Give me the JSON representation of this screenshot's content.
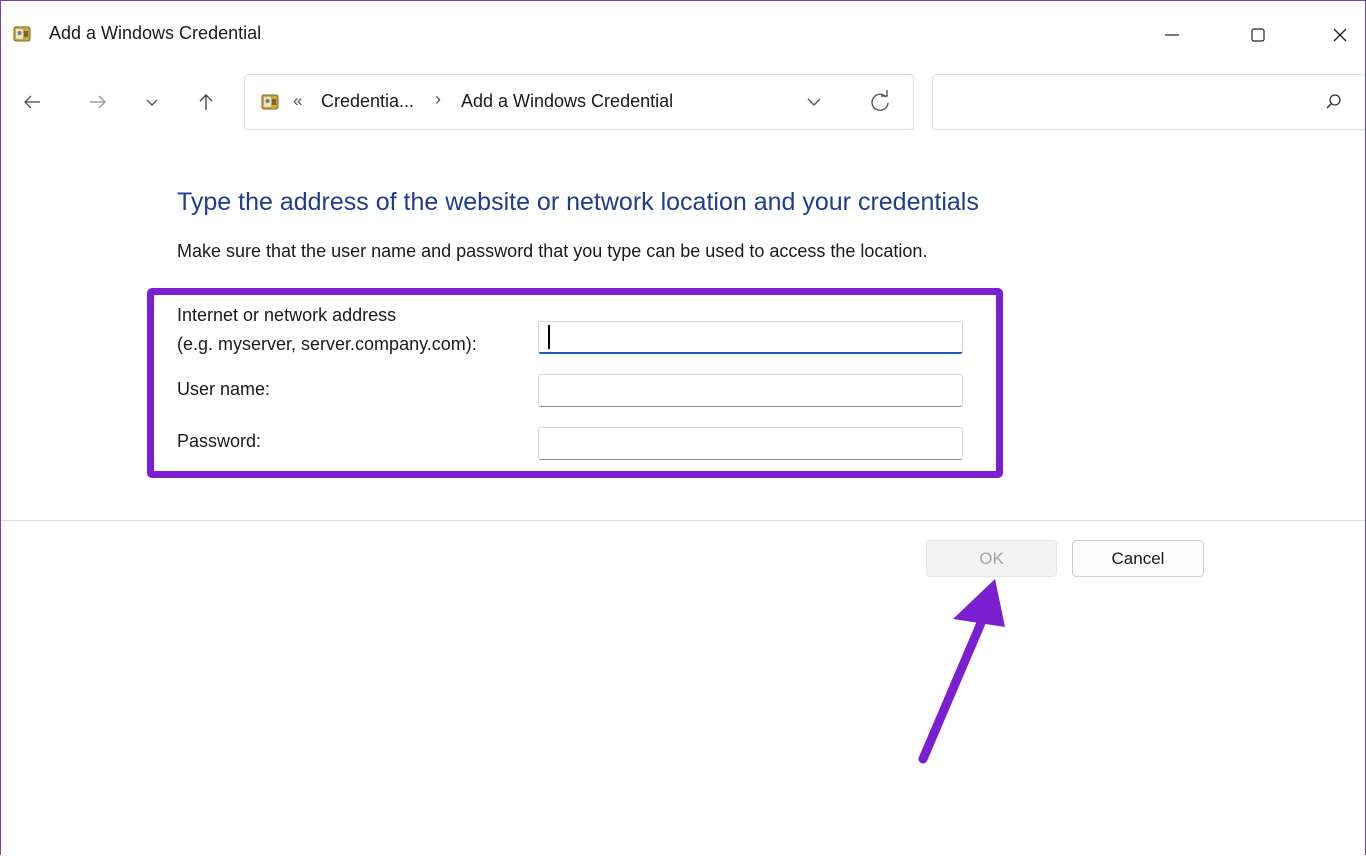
{
  "window": {
    "title": "Add a Windows Credential",
    "icon": "credential-manager-icon",
    "controls": [
      "minimize-icon",
      "maximize-icon",
      "close-icon"
    ]
  },
  "nav": {
    "icons": [
      "back-arrow-icon",
      "forward-arrow-icon",
      "chevron-down-icon",
      "up-arrow-icon"
    ]
  },
  "address_bar": {
    "separator_left": "«",
    "crumb1": "Credentia...",
    "separator": "›",
    "crumb2": "Add a Windows Credential"
  },
  "search": {
    "value": ""
  },
  "content": {
    "heading": "Type the address of the website or network location and your credentials",
    "subheading": "Make sure that the user name and password that you type can be used to access the location.",
    "address_label_line1": "Internet or network address",
    "address_label_line2": "(e.g. myserver, server.company.com):",
    "address_value": "",
    "username_label": "User name:",
    "username_value": "",
    "password_label": "Password:",
    "password_value": ""
  },
  "buttons": {
    "ok": "OK",
    "cancel": "Cancel"
  },
  "colors": {
    "heading": "#1e3d8f",
    "highlight": "#7a1fd1",
    "focus_underline": "#1a5fb4"
  }
}
